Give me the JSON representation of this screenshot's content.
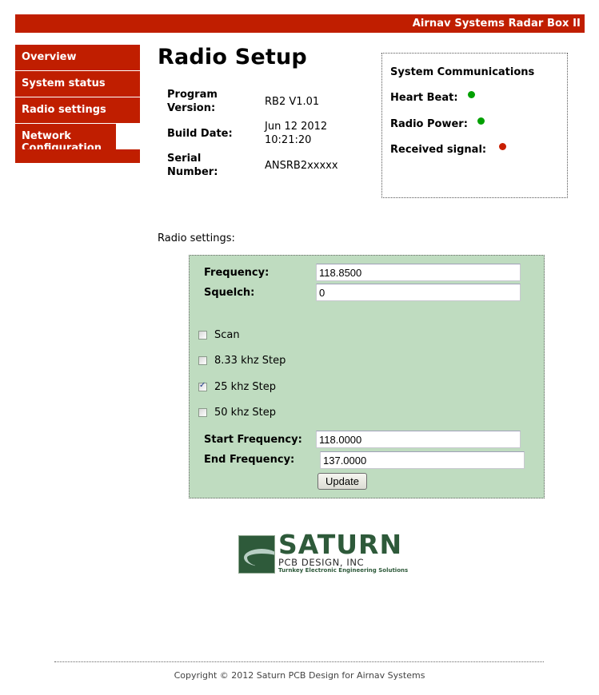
{
  "header": {
    "title": "Airnav Systems Radar Box II"
  },
  "sidebar": {
    "items": [
      {
        "label": "Overview"
      },
      {
        "label": "System status"
      },
      {
        "label": "Radio settings"
      },
      {
        "label": "Network Configuration"
      }
    ]
  },
  "page": {
    "title": "Radio Setup"
  },
  "info": {
    "program_version": {
      "label": "Program Version:",
      "value": "RB2 V1.01"
    },
    "build_date": {
      "label": "Build Date:",
      "value": "Jun 12 2012 10:21:20"
    },
    "serial_number": {
      "label": "Serial Number:",
      "value": "ANSRB2xxxxx"
    }
  },
  "communications": {
    "title": "System Communications",
    "heart_beat": {
      "label": "Heart Beat:",
      "status": "ok",
      "color": "#00a000"
    },
    "radio_power": {
      "label": "Radio Power:",
      "status": "ok",
      "color": "#00a000"
    },
    "received_signal": {
      "label": "Received signal:",
      "status": "off",
      "color": "#c81e00"
    }
  },
  "radio_settings": {
    "section_label": "Radio settings:",
    "frequency": {
      "label": "Frequency:",
      "value": "118.8500"
    },
    "squelch": {
      "label": "Squelch:",
      "value": "0"
    },
    "options": [
      {
        "label": "Scan",
        "checked": false
      },
      {
        "label": "8.33 khz Step",
        "checked": false
      },
      {
        "label": "25 khz Step",
        "checked": true
      },
      {
        "label": "50 khz Step",
        "checked": false
      }
    ],
    "start_frequency": {
      "label": "Start Frequency:",
      "value": "118.0000"
    },
    "end_frequency": {
      "label": "End Frequency:",
      "value": "137.0000"
    },
    "update_label": "Update"
  },
  "logo": {
    "name": "SATURN",
    "subtitle": "PCB DESIGN, INC",
    "tagline": "Turnkey Electronic Engineering Solutions"
  },
  "footer": {
    "copyright": "Copyright © 2012 Saturn PCB Design for Airnav Systems"
  },
  "colors": {
    "brand_red": "#c01e00",
    "panel_green": "#bfdcc0",
    "led_green": "#00a000",
    "led_red": "#c81e00"
  }
}
